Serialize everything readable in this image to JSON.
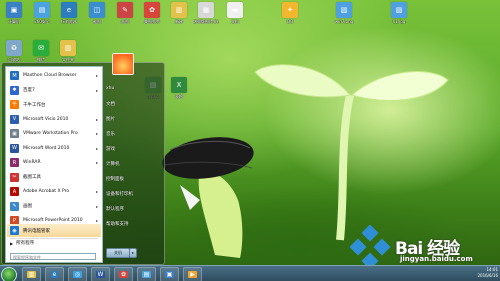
{
  "desktop": {
    "icons_top": [
      {
        "label": "计算机",
        "color": "#3b7fc4",
        "glyph": "▣"
      },
      {
        "label": "360安全",
        "color": "#4aa3df",
        "glyph": "▤"
      },
      {
        "label": "IE浏览器",
        "color": "#2c7cc0",
        "glyph": "e"
      },
      {
        "label": "截图",
        "color": "#3a8ed0",
        "glyph": "◫"
      },
      {
        "label": "画图",
        "color": "#c44",
        "glyph": "✎"
      },
      {
        "label": "美图秀秀",
        "color": "#d8453a",
        "glyph": "✿"
      },
      {
        "label": "新建",
        "color": "#e2c24a",
        "glyph": "▥"
      },
      {
        "label": "增强版图片文件夹",
        "color": "#d8d8d8",
        "glyph": "▦"
      },
      {
        "label": "文档",
        "color": "#f0f0f0",
        "glyph": "▬"
      },
      {
        "label": "QQ",
        "color": "#f2b72d",
        "glyph": "✦"
      },
      {
        "label": "win7.png",
        "color": "#4fa0e0",
        "glyph": "▧"
      },
      {
        "label": "01.jpg",
        "color": "#4fa0e0",
        "glyph": "▧"
      }
    ],
    "icons_left": [
      {
        "label": "回收站",
        "color": "#7fa8c8",
        "glyph": "♻"
      },
      {
        "label": "微信",
        "color": "#2aae3b",
        "glyph": "✉"
      },
      {
        "label": "文件夹",
        "color": "#e2c24a",
        "glyph": "▥"
      }
    ],
    "icons_mid": [
      {
        "label": "a.png",
        "color": "#5aaf4a",
        "glyph": "▧"
      },
      {
        "label": "表格",
        "color": "#2f8a3e",
        "glyph": "X"
      }
    ]
  },
  "start_menu": {
    "items": [
      {
        "label": "Maxthon Cloud Browser",
        "color": "#1f6fc0",
        "glyph": "M",
        "arrow": true,
        "highlight": false
      },
      {
        "label": "百度7",
        "color": "#2b66d1",
        "glyph": "✱",
        "arrow": true,
        "highlight": false
      },
      {
        "label": "千牛工作台",
        "color": "#ff7a00",
        "glyph": "千",
        "arrow": false,
        "highlight": false
      },
      {
        "label": "Microsoft Visio 2010",
        "color": "#2b5fae",
        "glyph": "V",
        "arrow": true,
        "highlight": false
      },
      {
        "label": "VMware Workstation Pro",
        "color": "#6d7e8c",
        "glyph": "▣",
        "arrow": true,
        "highlight": false
      },
      {
        "label": "Microsoft Word 2010",
        "color": "#2a5699",
        "glyph": "W",
        "arrow": true,
        "highlight": false
      },
      {
        "label": "WinRAR",
        "color": "#8a2b6b",
        "glyph": "R",
        "arrow": true,
        "highlight": false
      },
      {
        "label": "截图工具",
        "color": "#c33",
        "glyph": "✂",
        "arrow": false,
        "highlight": false
      },
      {
        "label": "Adobe Acrobat X Pro",
        "color": "#b30b00",
        "glyph": "A",
        "arrow": true,
        "highlight": false
      },
      {
        "label": "画图",
        "color": "#3a87c9",
        "glyph": "✎",
        "arrow": true,
        "highlight": false
      },
      {
        "label": "Microsoft PowerPoint 2010",
        "color": "#d04a24",
        "glyph": "P",
        "arrow": true,
        "highlight": false
      },
      {
        "label": "腾讯电脑管家",
        "color": "#1d78d0",
        "glyph": "◉",
        "arrow": false,
        "highlight": true
      }
    ],
    "all_programs": "所有程序",
    "search_placeholder": "搜索程序和文件",
    "right_items": [
      "xhu",
      "文档",
      "图片",
      "音乐",
      "游戏",
      "计算机",
      "控制面板",
      "设备和打印机",
      "默认程序",
      "帮助和支持"
    ],
    "shutdown_label": "关机",
    "shutdown_arrow": "▸"
  },
  "taskbar": {
    "buttons": [
      {
        "glyph": "▥",
        "color": "#e2c24a"
      },
      {
        "glyph": "e",
        "color": "#2c7cc0"
      },
      {
        "glyph": "◎",
        "color": "#3aa0e0"
      },
      {
        "glyph": "W",
        "color": "#2a5699"
      },
      {
        "glyph": "✿",
        "color": "#d8453a"
      },
      {
        "glyph": "▤",
        "color": "#4aa3df"
      },
      {
        "glyph": "▣",
        "color": "#3b7fc4"
      },
      {
        "glyph": "▶",
        "color": "#f2a52d"
      }
    ],
    "time": "14:01",
    "date": "2016/6/16"
  },
  "watermark": {
    "text": "Bai 经验",
    "url": "jingyan.baidu.com"
  }
}
